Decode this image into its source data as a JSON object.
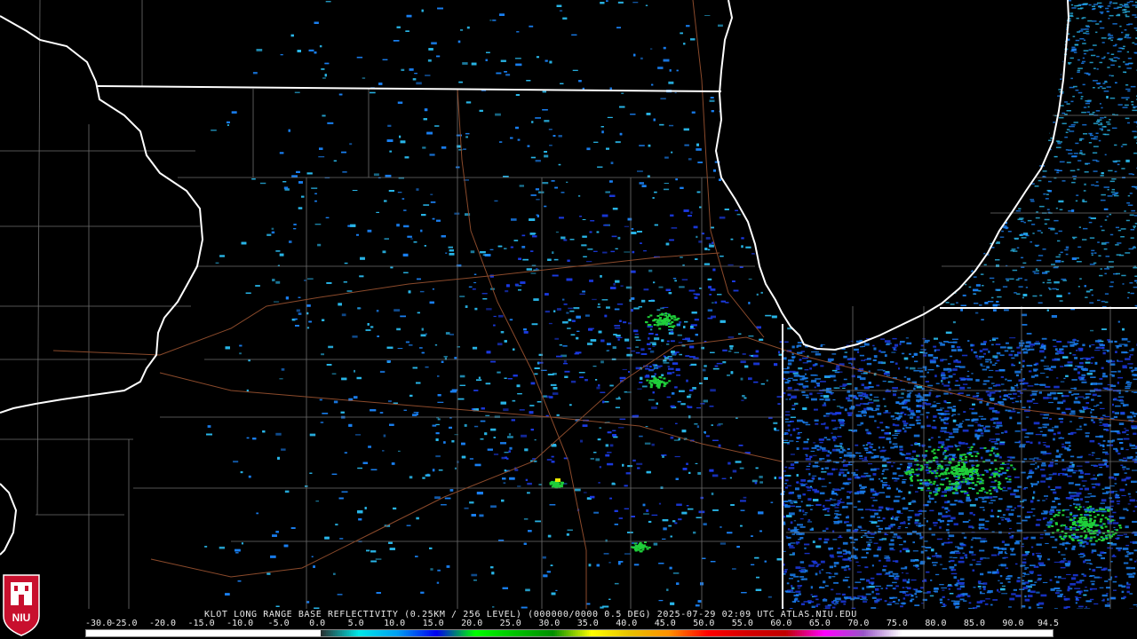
{
  "product": {
    "title_text": "KLOT LONG RANGE BASE REFLECTIVITY (0.25KM / 256 LEVEL) (000000/0000 0.5 DEG) 2025-07-29 02:09 UTC  ATLAS.NIU.EDU",
    "station": "KLOT",
    "product_name": "LONG RANGE BASE REFLECTIVITY",
    "resolution": "0.25KM / 256 LEVEL",
    "elevation": "0.5 DEG",
    "timestamp": "2025-07-29 02:09 UTC",
    "source": "ATLAS.NIU.EDU"
  },
  "colorbar": {
    "labels": [
      "-30.0",
      "-25.0",
      "-20.0",
      "-15.0",
      "-10.0",
      "-5.0",
      "0.0",
      "5.0",
      "10.0",
      "15.0",
      "20.0",
      "25.0",
      "30.0",
      "35.0",
      "40.0",
      "45.0",
      "50.0",
      "55.0",
      "60.0",
      "65.0",
      "70.0",
      "75.0",
      "80.0",
      "85.0",
      "90.0",
      "94.5"
    ],
    "min": -30.0,
    "max": 94.5,
    "colors": [
      {
        "v": -30,
        "c": "#ffffff"
      },
      {
        "v": 0,
        "c": "#ffffff"
      },
      {
        "v": 0.01,
        "c": "#2a2a2a"
      },
      {
        "v": 5,
        "c": "#00e8e8"
      },
      {
        "v": 10,
        "c": "#009ff2"
      },
      {
        "v": 15,
        "c": "#0000f0"
      },
      {
        "v": 20,
        "c": "#00ff00"
      },
      {
        "v": 25,
        "c": "#00c400"
      },
      {
        "v": 30,
        "c": "#008f00"
      },
      {
        "v": 35,
        "c": "#ffff00"
      },
      {
        "v": 40,
        "c": "#e7c000"
      },
      {
        "v": 45,
        "c": "#ff9000"
      },
      {
        "v": 50,
        "c": "#ff0000"
      },
      {
        "v": 55,
        "c": "#d60000"
      },
      {
        "v": 60,
        "c": "#c00000"
      },
      {
        "v": 65,
        "c": "#ff00ff"
      },
      {
        "v": 70,
        "c": "#9955c9"
      },
      {
        "v": 75,
        "c": "#ffffff"
      },
      {
        "v": 94.5,
        "c": "#ffffff"
      }
    ]
  },
  "map": {
    "background": "#000000",
    "lake_name": "Lake Michigan",
    "state_border_color": "#ffffff",
    "county_border_color": "#7a7a7a",
    "highway_color": "#8b4a2b",
    "echo_colors": {
      "light": "#29b6e8",
      "mid": "#1a7ff0",
      "dense": "#1b3ae0",
      "green": "#1fcf3a",
      "yellow": "#e8e800"
    }
  },
  "logo": {
    "text": "NIU",
    "color": "#c8102e"
  }
}
